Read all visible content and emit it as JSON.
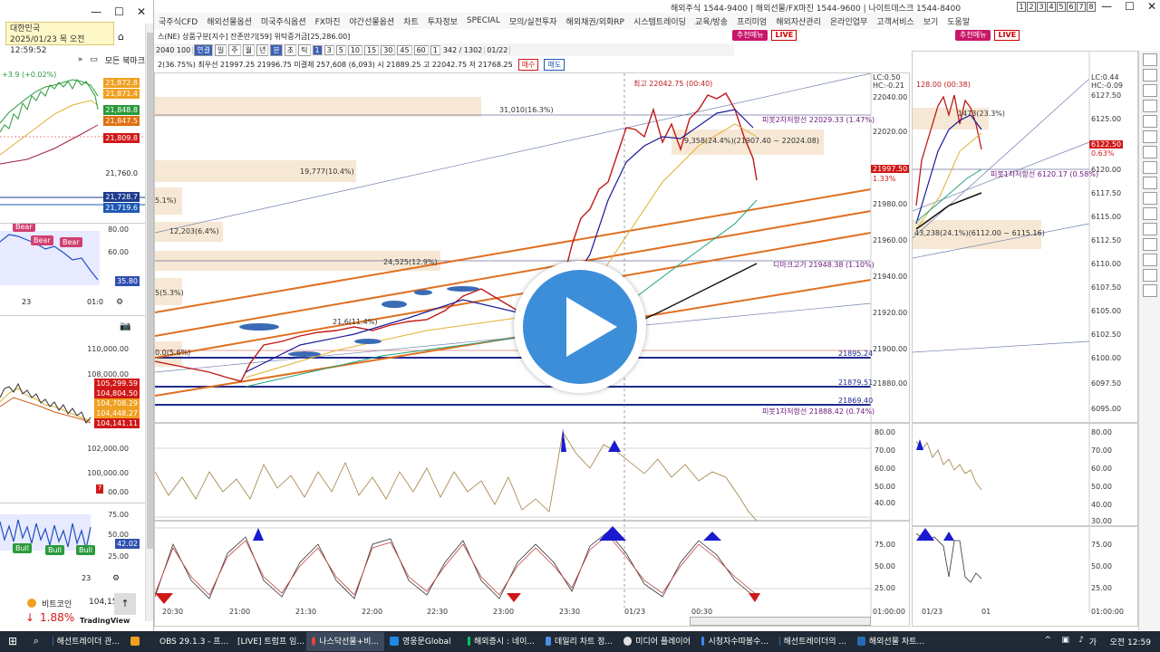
{
  "left_panel": {
    "location_line1": "대한민국",
    "location_line2": "2025/01/23 목 오전 12:59:52",
    "bookmarks_label": "모든 북마크",
    "expand_label": "»",
    "nasdaq_change": "+3.9 (+0.02%)",
    "price_labels": [
      "21,872.8",
      "21,871.4",
      "21,848.8",
      "21,847.5",
      "21,809.8",
      "21,760.0",
      "21,728.7",
      "21,719.6"
    ],
    "price_colors": [
      "#f0a020",
      "#f0a020",
      "#2a9a3a",
      "#e07010",
      "#d01818",
      "",
      "#1e3c8c",
      "#1e5ab4"
    ],
    "rsi_labels": [
      "80.00",
      "60.00",
      "35.80"
    ],
    "bear_tags": [
      "Bear",
      "Bear",
      "Bear"
    ],
    "date_label": "23",
    "time_label": "01:0",
    "btc_labels": [
      "110,000.00",
      "108,000.00",
      "105,299.59",
      "104,804.50",
      "104,708.29",
      "104,448.27",
      "104,141.11",
      "102,000.00",
      "100,000.00"
    ],
    "btc_colors": [
      "",
      "",
      "#d01818",
      "#d01818",
      "#f0a020",
      "#f0a020",
      "#d01818",
      "",
      ""
    ],
    "osc_labels": [
      "75.00",
      "50.00",
      "42.02",
      "25.00"
    ],
    "bull_tags": [
      "Bull",
      "Bull",
      "Bull"
    ],
    "date_label2": "23",
    "osc_marker": "7",
    "osc_label_top": "00.00",
    "ticker_name": "비트코인",
    "ticker_price": "104,150.92",
    "ticker_change": "1.88%",
    "ticker_source": "TradingView"
  },
  "app": {
    "top_info": "해외주식 1544-9400 | 해외선물/FX마진 1544-9600 | 나이트데스크 1544-8400",
    "window_numbers": [
      "1",
      "2",
      "3",
      "4",
      "5",
      "6",
      "7",
      "8"
    ],
    "menu": [
      "국주식CFD",
      "해외선물옵션",
      "미국주식옵션",
      "FX마진",
      "야간선물옵션",
      "차트",
      "투자정보",
      "SPECIAL",
      "모의/실전투자",
      "해외채권/외화RP",
      "시스템트레이딩",
      "교육/방송",
      "프리미엄",
      "해외자산관리",
      "온라인업무",
      "고객서비스",
      "보기",
      "도움말"
    ],
    "recommend_label": "추천메뉴",
    "live_label": "LIVE",
    "main_toolbar": {
      "code": "2040 100",
      "type_buttons": [
        "연결",
        "일",
        "주",
        "월",
        "년",
        "분",
        "초",
        "틱"
      ],
      "interval_buttons": [
        "1",
        "3",
        "5",
        "10",
        "15",
        "30",
        "45",
        "60"
      ],
      "count": "1",
      "range": "342 / 1302",
      "date": "01/22"
    },
    "main_infobar": {
      "title": "스(NE) 상품구분[지수] 잔존만기[59] 위탁증거금[25,286.00]",
      "quote": "2(36.75%) 최우선 21997.25  21996.75 미결제 257,608 (6,093) 시 21889.25 고 22042.75 저 21768.25",
      "buy": "매수",
      "sell": "매도"
    },
    "main_chart": {
      "high_note": "최고 22042.75 (00:40)",
      "lc": "LC:0.50",
      "hc": "HC:-0.21",
      "current_price": "21997.50",
      "current_pct": "1.33%",
      "y_labels": [
        "22040.00",
        "22020.00",
        "22000.00",
        "21980.00",
        "21960.00",
        "21940.00",
        "21920.00",
        "21900.00",
        "21880.00"
      ],
      "fib_labels": [
        "31,010(16.3%)",
        "19,777(10.4%)",
        "5.1%)",
        "12,203(6.4%)",
        "24,525(12.9%)",
        "5(5.3%)",
        "21,6(11.4%)",
        "0.0(5.6%)",
        "9,358(24.4%)(21907.40 ~ 22024.08)"
      ],
      "pivot1": "피봇2차저항선 22029.33 (1.47%)",
      "pivot2": "디마크고가 21948.38 (1.10%)",
      "pivot3": "피봇1차저항선 21888.42 (0.74%)",
      "level_labels": [
        "21895.24",
        "21879.51",
        "21869.40"
      ],
      "rsi_y": [
        "80.00",
        "70.00",
        "60.00",
        "50.00",
        "40.00"
      ],
      "stoch_y": [
        "75.00",
        "50.00",
        "25.00"
      ],
      "x_labels": [
        "20:30",
        "21:00",
        "21:30",
        "22:00",
        "22:30",
        "23:00",
        "23:30",
        "01/23",
        "00:30"
      ],
      "x_end": "01:00:00"
    },
    "right_chart": {
      "high_note": "128.00 (00:38)",
      "lc": "LC:0.44",
      "hc": "HC:-0.09",
      "current_price": "6122.50",
      "current_pct": "0.63%",
      "fib1": "1473(23.3%)",
      "fib2": "43,238(24.1%)(6112.00 ~ 6115.16)",
      "pivot": "피봇1차저항선 6120.17 (0.58%)",
      "y_labels": [
        "6127.50",
        "6125.00",
        "6122.50",
        "6120.00",
        "6117.50",
        "6115.00",
        "6112.50",
        "6110.00",
        "6107.50",
        "6105.00",
        "6102.50",
        "6100.00",
        "6097.50",
        "6095.00"
      ],
      "rsi_y": [
        "80.00",
        "70.00",
        "60.00",
        "50.00",
        "40.00",
        "30.00"
      ],
      "stoch_y": [
        "75.00",
        "50.00",
        "25.00"
      ],
      "x_labels": [
        "01/23",
        "01"
      ],
      "x_end": "01:00:00"
    }
  },
  "taskbar": {
    "apps": [
      "해선트레이더 관...",
      "",
      "OBS 29.1.3 - 프...",
      "[LIVE] 트럼프 임...",
      "나스닥선물+비...",
      "영웅문Global",
      "해외증시 : 네이...",
      "데일리 차트 정...",
      "미디어 플레이어",
      "시청자수따봉수...",
      "해선트레이더의 ...",
      "해외선물 차트..."
    ],
    "app_colors": [
      "#2a6ab4",
      "#f0a020",
      "#444",
      "#ea4335",
      "#ea4335",
      "#1e88e5",
      "#03c75a",
      "#4a90e2",
      "#e0e0e0",
      "#4285f4",
      "#2a6ab4",
      "#2a6ab4"
    ],
    "time": "오전 12:59",
    "lang": "가"
  }
}
